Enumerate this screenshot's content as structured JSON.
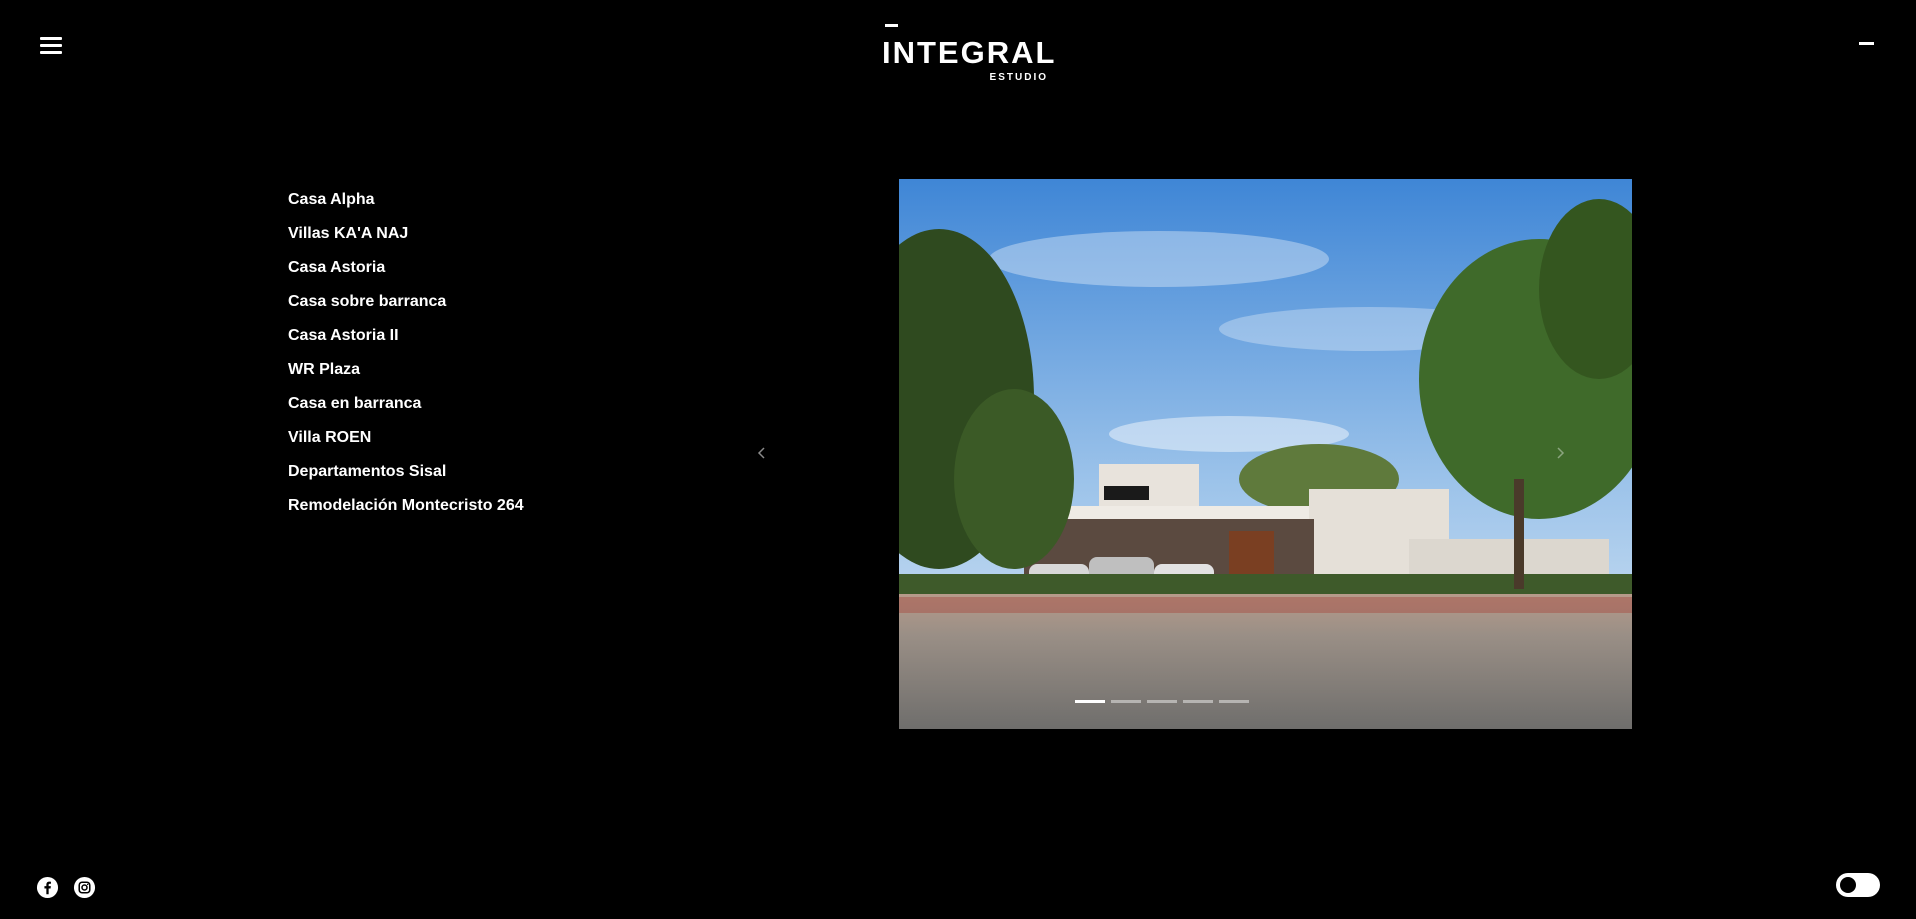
{
  "header": {
    "logo_main": "INTEGRAL",
    "logo_sub": "ESTUDIO"
  },
  "projects": [
    "Casa Alpha",
    "Villas KA'A NAJ",
    "Casa Astoria",
    "Casa sobre barranca",
    "Casa Astoria II",
    "WR Plaza",
    "Casa en barranca",
    "Villa ROEN",
    "Departamentos Sisal",
    "Remodelación Montecristo 264"
  ],
  "slider": {
    "slide_count": 5,
    "active_index": 0
  },
  "icons": {
    "menu": "hamburger-menu-icon",
    "minimize": "minus-icon",
    "prev": "chevron-left-icon",
    "next": "chevron-right-icon",
    "facebook": "facebook-icon",
    "instagram": "instagram-icon",
    "theme": "toggle-switch"
  },
  "colors": {
    "background": "#000000",
    "text": "#ffffff"
  }
}
